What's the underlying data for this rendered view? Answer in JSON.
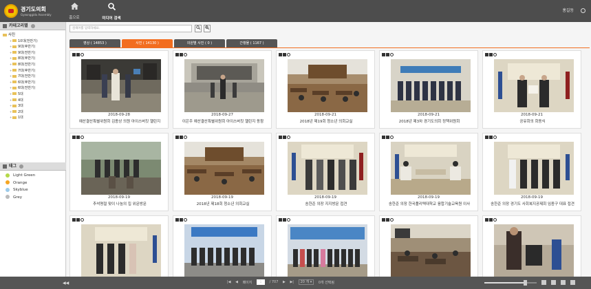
{
  "header": {
    "logo_text": "경기도의회",
    "logo_sub": "Gyeonggido Assembly",
    "nav_home": "홈으로",
    "nav_media": "미디어 검색",
    "user_name": "홍길동"
  },
  "sidebar": {
    "category_title": "카테고리별",
    "tree_root": "사진",
    "tree_items": [
      "10대(전반기)",
      "9대(후반기)",
      "9대(전반기)",
      "8대(후반기)",
      "8대(전반기)",
      "7대(후반기)",
      "7대(전반기)",
      "6대(후반기)",
      "6대(전반기)",
      "5대",
      "4대",
      "3대",
      "2대",
      "1대"
    ],
    "tags_title": "태그",
    "tags": [
      {
        "label": "Light Green",
        "color": "#b4d94a"
      },
      {
        "label": "Orange",
        "color": "#f5a623"
      },
      {
        "label": "Skyblue",
        "color": "#9ccbea"
      },
      {
        "label": "Grey",
        "color": "#bbbbbb"
      }
    ]
  },
  "search": {
    "placeholder": "검색어를 입력하세요."
  },
  "tabs": [
    {
      "label": "영상 ( 14853 )"
    },
    {
      "label": "사진 ( 14130 )"
    },
    {
      "label": "의원별 사진 ( 0 )"
    },
    {
      "label": "간행물 ( 1167 )"
    }
  ],
  "cards": [
    {
      "date": "2018-09-28",
      "title": "예산결산특별위원회 김종상 의원 아이스버킷 챌린지"
    },
    {
      "date": "2018-09-27",
      "title": "이은주 예산결산특별위원회 아이스버킷 챌린지 동참"
    },
    {
      "date": "2018-09-21",
      "title": "2018년 제19회 청소년 의회교실"
    },
    {
      "date": "2018-09-21",
      "title": "2018년 제3차 경기도의회 정책위원회"
    },
    {
      "date": "2018-09-21",
      "title": "공유회의 회동식"
    },
    {
      "date": "2018-09-19",
      "title": "추석명절 맞이 나눔의 집 위문방문"
    },
    {
      "date": "2018-09-19",
      "title": "2018년 제18회 청소년 의회교실"
    },
    {
      "date": "2018-09-19",
      "title": "송한준 의장 지지방문 접견"
    },
    {
      "date": "2018-09-19",
      "title": "송한준 의장 한국폴리텍대학교 융합기술교육원 이사"
    },
    {
      "date": "2018-09-19",
      "title": "송한준 의장 경기도 사회복지공제회 임종구 대표 접견"
    },
    {
      "date": "",
      "title": ""
    },
    {
      "date": "",
      "title": ""
    },
    {
      "date": "",
      "title": ""
    },
    {
      "date": "",
      "title": ""
    },
    {
      "date": "",
      "title": ""
    }
  ],
  "footer": {
    "page_label": "페이지",
    "page_current": "1",
    "page_total": "/ 707",
    "per_page": "20 개 ▾",
    "selected": "0개 선택됨",
    "zoom_level": 0.78
  },
  "colors": {
    "accent": "#f26d1f",
    "topbar": "#4d4d4d",
    "tab": "#555555"
  }
}
